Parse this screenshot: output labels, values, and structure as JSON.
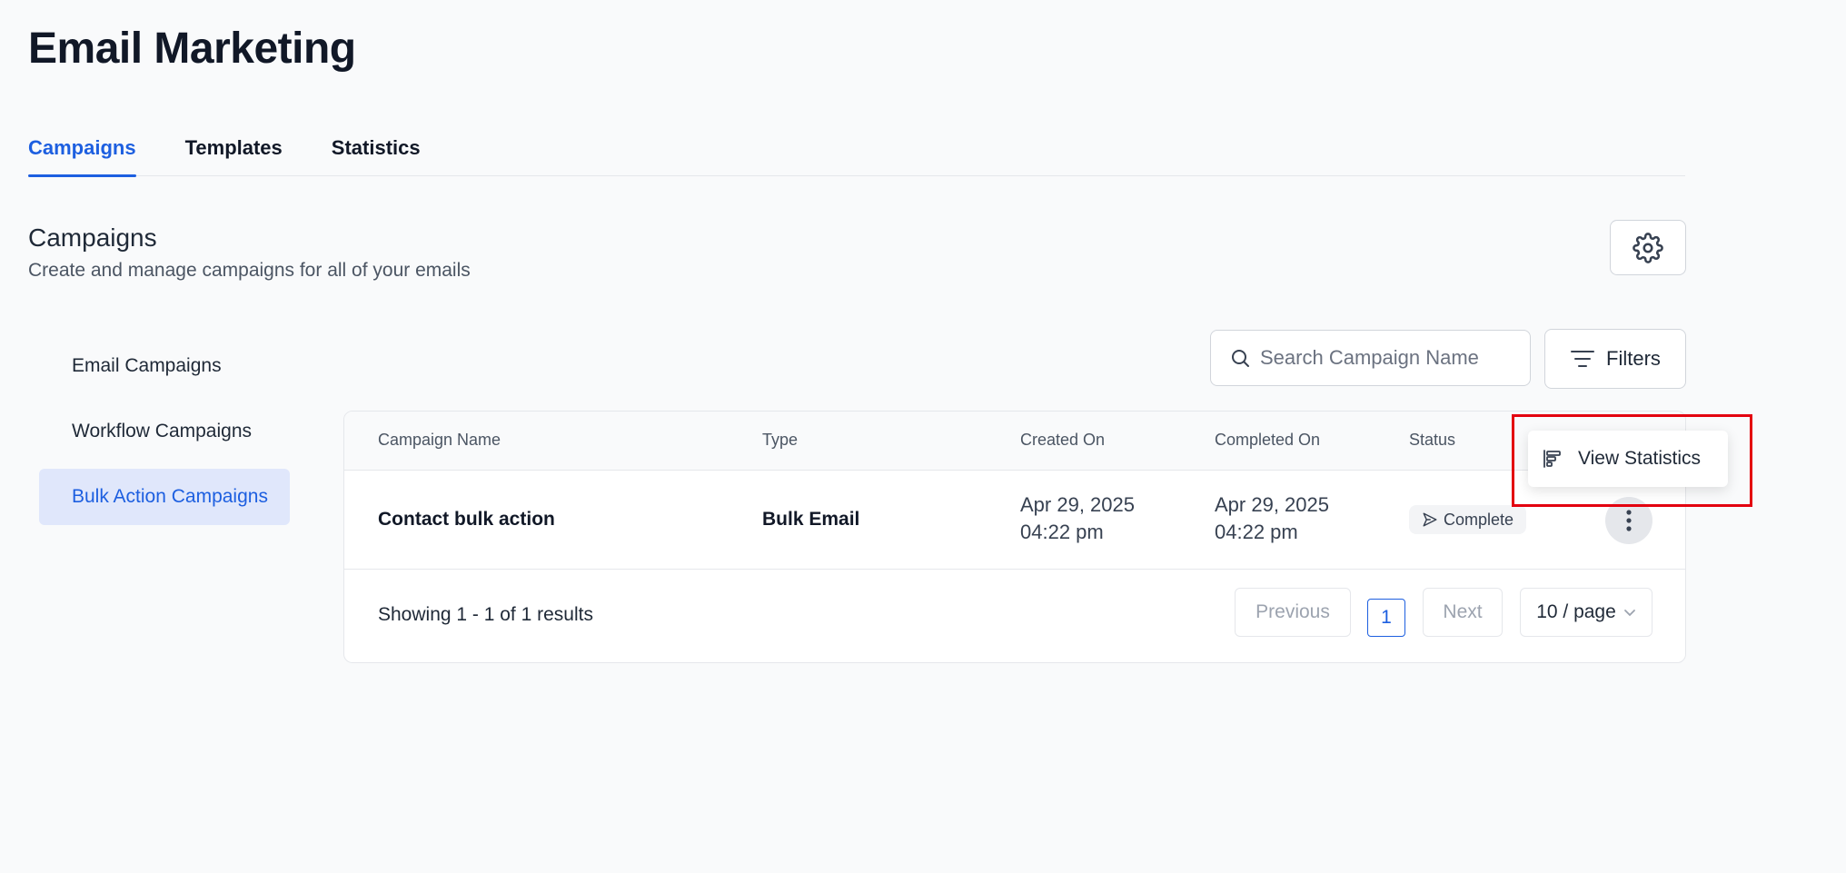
{
  "page": {
    "title": "Email Marketing"
  },
  "tabs": [
    {
      "label": "Campaigns",
      "active": true
    },
    {
      "label": "Templates",
      "active": false
    },
    {
      "label": "Statistics",
      "active": false
    }
  ],
  "section": {
    "title": "Campaigns",
    "subtitle": "Create and manage campaigns for all of your emails",
    "settings_icon": "gear-icon"
  },
  "sidebar": {
    "items": [
      {
        "label": "Email Campaigns",
        "active": false
      },
      {
        "label": "Workflow Campaigns",
        "active": false
      },
      {
        "label": "Bulk Action Campaigns",
        "active": true
      }
    ]
  },
  "toolbar": {
    "search_placeholder": "Search Campaign Name",
    "search_value": "",
    "filters_label": "Filters"
  },
  "table": {
    "columns": [
      "Campaign Name",
      "Type",
      "Created On",
      "Completed On",
      "Status"
    ],
    "rows": [
      {
        "name": "Contact bulk action",
        "type": "Bulk Email",
        "created_date": "Apr 29, 2025",
        "created_time": "04:22 pm",
        "completed_date": "Apr 29, 2025",
        "completed_time": "04:22 pm",
        "status": "Complete"
      }
    ]
  },
  "pagination": {
    "results_text": "Showing 1 - 1 of 1 results",
    "previous_label": "Previous",
    "current_page": "1",
    "next_label": "Next",
    "per_page_label": "10 / page"
  },
  "dropdown": {
    "items": [
      {
        "label": "View Statistics",
        "icon": "statistics-icon"
      }
    ]
  },
  "colors": {
    "accent": "#1d5fe0",
    "highlight": "#e3000f",
    "background": "#f9fafb"
  }
}
